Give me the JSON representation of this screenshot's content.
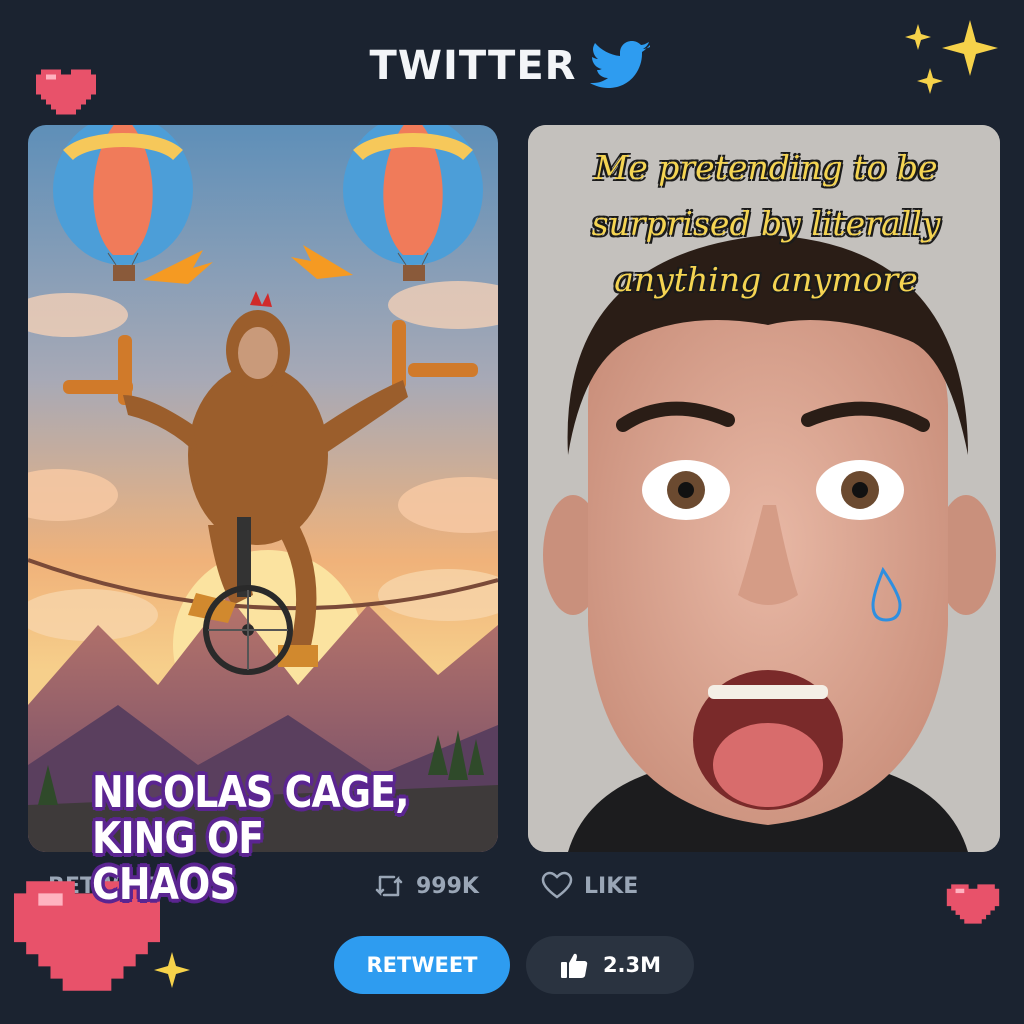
{
  "header": {
    "title": "TWITTER"
  },
  "left_post": {
    "caption": "NICOLAS CAGE,\nKING OF CHAOS"
  },
  "right_post": {
    "caption": "Me pretending to be\nsurprised by literally\nanything anymore"
  },
  "stats": {
    "retweet_label": "RETWEET",
    "retweet_count": "999K",
    "like_label": "LIKE"
  },
  "buttons": {
    "retweet": "RETWEET",
    "likes": "2.3M"
  },
  "colors": {
    "background": "#1b2330",
    "twitter_blue": "#2e9cf0",
    "caption_yellow": "#f4d452",
    "caption_purple": "#5b2591"
  }
}
